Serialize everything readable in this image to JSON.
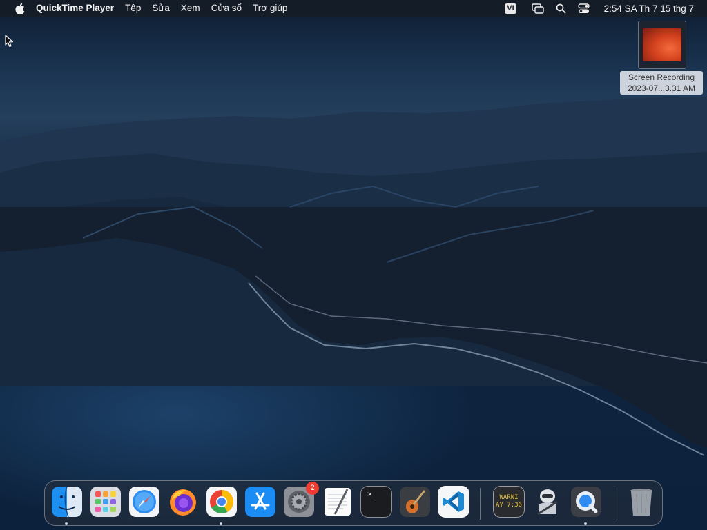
{
  "menubar": {
    "app_name": "QuickTime Player",
    "menus": [
      "Tệp",
      "Sửa",
      "Xem",
      "Cửa sổ",
      "Trợ giúp"
    ],
    "input_source": "VI",
    "clock": "2:54 SA Th 7 15 thg 7",
    "status_icons": [
      "screen-mirroring-icon",
      "spotlight-search-icon",
      "control-center-icon"
    ]
  },
  "desktop": {
    "file": {
      "label_line1": "Screen Recording",
      "label_line2": "2023-07...3.31 AM"
    }
  },
  "dock": {
    "apps": [
      {
        "name": "Finder",
        "icon": "finder-icon",
        "running": true
      },
      {
        "name": "Launchpad",
        "icon": "launchpad-icon",
        "running": false
      },
      {
        "name": "Safari",
        "icon": "safari-icon",
        "running": false
      },
      {
        "name": "Firefox",
        "icon": "firefox-icon",
        "running": false
      },
      {
        "name": "Google Chrome",
        "icon": "chrome-icon",
        "running": true
      },
      {
        "name": "App Store",
        "icon": "app-store-icon",
        "running": false
      },
      {
        "name": "System Preferences",
        "icon": "system-preferences-icon",
        "running": false,
        "badge": "2"
      },
      {
        "name": "TextEdit",
        "icon": "textedit-icon",
        "running": false
      },
      {
        "name": "Terminal",
        "icon": "terminal-icon",
        "running": false
      },
      {
        "name": "GarageBand",
        "icon": "garageband-icon",
        "running": false
      },
      {
        "name": "Visual Studio Code",
        "icon": "vscode-icon",
        "running": false
      },
      {
        "name": "Console",
        "icon": "console-icon",
        "running": false
      },
      {
        "name": "Automator",
        "icon": "automator-icon",
        "running": false
      },
      {
        "name": "QuickTime Player",
        "icon": "quicktime-icon",
        "running": true
      },
      {
        "name": "Trash",
        "icon": "trash-icon",
        "running": false
      }
    ],
    "terminal_prompt": ">_",
    "console_line1": "WARNI",
    "console_line2": "AY 7:36"
  }
}
